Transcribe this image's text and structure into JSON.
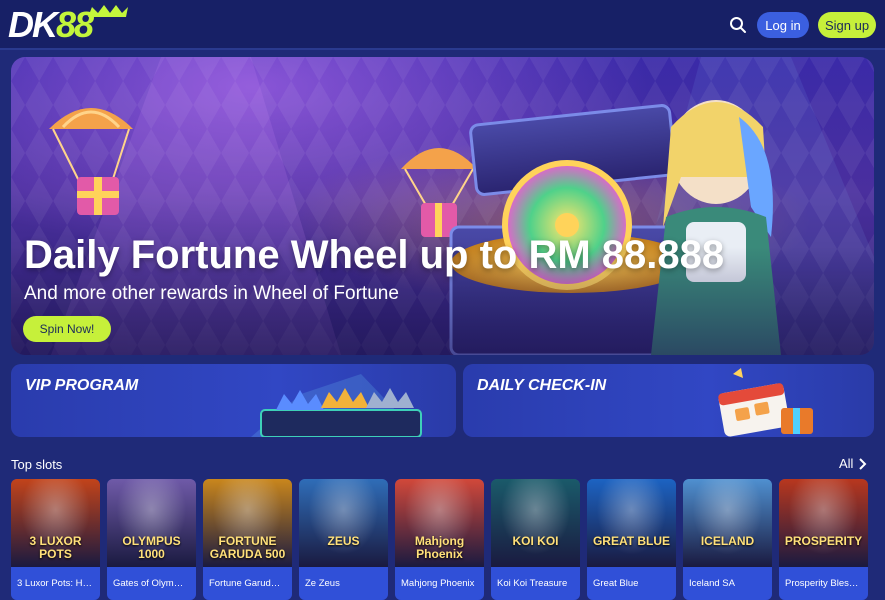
{
  "header": {
    "logo": {
      "main": "DK",
      "accent": "88"
    },
    "search_icon": "search-icon",
    "login_label": "Log in",
    "signup_label": "Sign up"
  },
  "hero": {
    "title": "Daily Fortune Wheel up to RM 88.888",
    "subtitle": "And more other rewards in Wheel of Fortune",
    "button_label": "Spin Now!"
  },
  "promos": [
    {
      "title": "VIP PROGRAM"
    },
    {
      "title": "DAILY CHECK-IN"
    }
  ],
  "top_slots": {
    "title": "Top slots",
    "all_label": "All",
    "items": [
      {
        "name": "3 Luxor Pots: H…",
        "logo": "3 LUXOR POTS",
        "color": "#c2431a"
      },
      {
        "name": "Gates of Olym…",
        "logo": "OLYMPUS 1000",
        "color": "#6f5aa8"
      },
      {
        "name": "Fortune Garud…",
        "logo": "FORTUNE GARUDA 500",
        "color": "#c9861c"
      },
      {
        "name": "Ze Zeus",
        "logo": "ZEUS",
        "color": "#2f6db8"
      },
      {
        "name": "Mahjong Phoenix",
        "logo": "Mahjong Phoenix",
        "color": "#d1483a"
      },
      {
        "name": "Koi Koi Treasure",
        "logo": "KOI KOI",
        "color": "#1a5a6a"
      },
      {
        "name": "Great Blue",
        "logo": "GREAT BLUE",
        "color": "#1c63c2"
      },
      {
        "name": "Iceland SA",
        "logo": "ICELAND",
        "color": "#4f90d0"
      },
      {
        "name": "Prosperity Bles…",
        "logo": "PROSPERITY",
        "color": "#b8371e"
      }
    ]
  }
}
